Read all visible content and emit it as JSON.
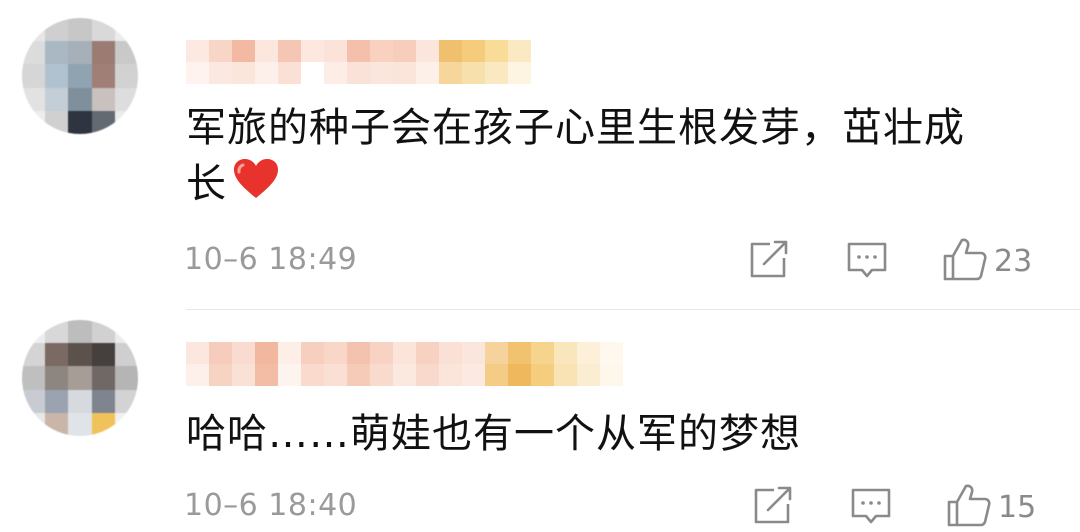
{
  "comments": [
    {
      "text_line1": "军旅的种子会在孩子心里生根发芽，茁壮成",
      "text_line2": "长",
      "emoji_icon": "red-heart-icon",
      "time": "10–6 18:49",
      "likes": "23"
    },
    {
      "text_line1": "哈哈……萌娃也有一个从军的梦想",
      "time": "10–6 18:40",
      "likes": "15"
    }
  ],
  "icons": {
    "share": "share-icon",
    "comment": "comment-icon",
    "like": "thumbs-up-icon"
  },
  "colors": {
    "text": "#111111",
    "meta": "#9a9a9a",
    "icon": "#8a8a8a",
    "heart": "#e8332c"
  }
}
